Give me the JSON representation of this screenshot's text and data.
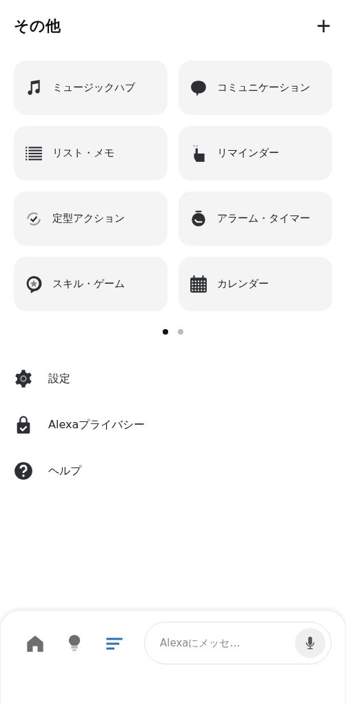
{
  "header": {
    "title": "その他",
    "add_button": "+"
  },
  "tiles": [
    {
      "label": "ミュージックハブ"
    },
    {
      "label": "コミュニケーション"
    },
    {
      "label": "リスト・メモ"
    },
    {
      "label": "リマインダー"
    },
    {
      "label": "定型アクション"
    },
    {
      "label": "アラーム・タイマー"
    },
    {
      "label": "スキル・ゲーム"
    },
    {
      "label": "カレンダー"
    }
  ],
  "pager": [
    {
      "selected": true
    },
    {
      "selected": false
    }
  ],
  "menu": [
    {
      "label": "設定"
    },
    {
      "label": "Alexaプライバシー"
    },
    {
      "label": "ヘルプ"
    }
  ],
  "bottom_nav": {
    "tabs": [
      {
        "selected": false
      },
      {
        "selected": false
      },
      {
        "selected": true
      }
    ],
    "message_field": {
      "placeholder": "Alexaにメッセ…"
    }
  }
}
